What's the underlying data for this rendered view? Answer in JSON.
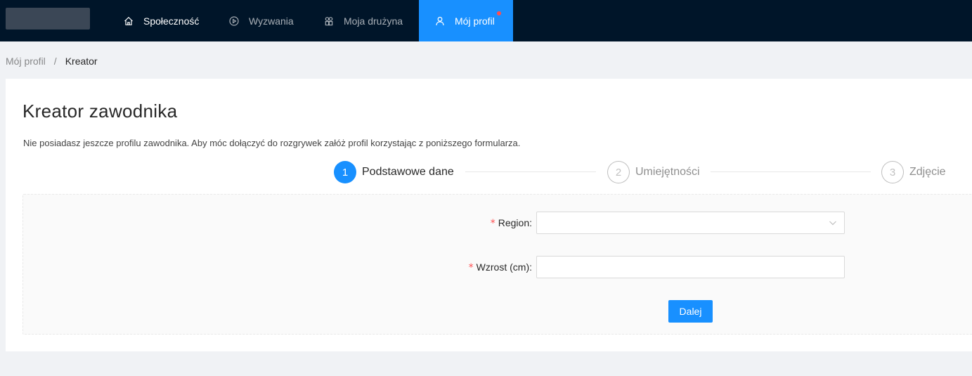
{
  "nav": {
    "items": [
      {
        "label": "Społeczność",
        "icon": "home-icon"
      },
      {
        "label": "Wyzwania",
        "icon": "play-circle-icon"
      },
      {
        "label": "Moja drużyna",
        "icon": "team-icon"
      },
      {
        "label": "Mój profil",
        "icon": "user-icon"
      }
    ],
    "active_index": 3,
    "accent_color": "#1890ff",
    "notification_dot_color": "#ff4d4f"
  },
  "breadcrumb": {
    "items": [
      "Mój profil",
      "Kreator"
    ],
    "separator": "/"
  },
  "page": {
    "title": "Kreator zawodnika",
    "description": "Nie posiadasz jeszcze profilu zawodnika. Aby móc dołączyć do rozgrywek załóż profil korzystając z poniższego formularza."
  },
  "steps": [
    {
      "number": "1",
      "label": "Podstawowe dane",
      "status": "active"
    },
    {
      "number": "2",
      "label": "Umiejętności",
      "status": "wait"
    },
    {
      "number": "3",
      "label": "Zdjęcie",
      "status": "wait"
    }
  ],
  "form": {
    "required_mark": "*",
    "region": {
      "label": "Region",
      "value": ""
    },
    "height": {
      "label": "Wzrost (cm)",
      "value": ""
    },
    "submit_label": "Dalej"
  }
}
